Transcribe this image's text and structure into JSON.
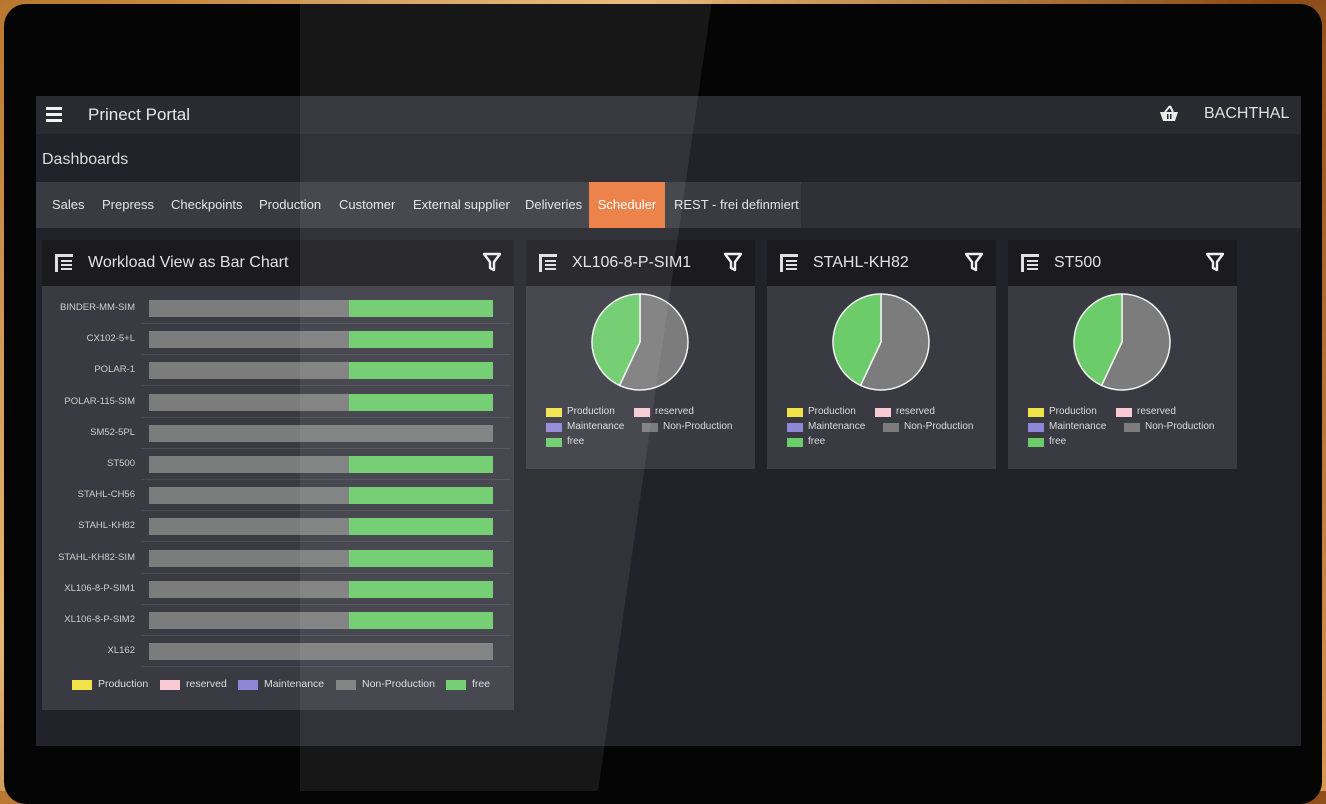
{
  "app": {
    "title": "Prinect Portal",
    "user": "BACHTHAL",
    "section": "Dashboards"
  },
  "tabs": [
    {
      "label": "Sales"
    },
    {
      "label": "Prepress"
    },
    {
      "label": "Checkpoints"
    },
    {
      "label": "Production"
    },
    {
      "label": "Customer"
    },
    {
      "label": "External supplier"
    },
    {
      "label": "Deliveries"
    },
    {
      "label": "Scheduler",
      "active": true
    },
    {
      "label": "REST - frei definmiert"
    }
  ],
  "colors": {
    "accent": "#ea7a3c",
    "production": "#f2e24a",
    "reserved": "#f7c9d3",
    "maintenance": "#8f86d6",
    "non_production": "#7c7c7c",
    "free": "#6dcc6a"
  },
  "icons": {
    "menu": "hamburger-icon",
    "basket": "basket-icon",
    "table": "table-icon",
    "filter": "filter-icon"
  },
  "bar_panel": {
    "title": "Workload View as Bar Chart",
    "legend": [
      "Production",
      "reserved",
      "Maintenance",
      "Non-Production",
      "free"
    ]
  },
  "pie_panels": [
    {
      "title": "XL106-8-P-SIM1",
      "legend": [
        "Production",
        "reserved",
        "Maintenance",
        "Non-Production",
        "free"
      ]
    },
    {
      "title": "STAHL-KH82",
      "legend": [
        "Production",
        "reserved",
        "Maintenance",
        "Non-Production",
        "free"
      ]
    },
    {
      "title": "ST500",
      "legend": [
        "Production",
        "reserved",
        "Maintenance",
        "Non-Production",
        "free"
      ]
    }
  ],
  "chart_data": [
    {
      "type": "bar",
      "orientation": "horizontal",
      "stacked": true,
      "title": "Workload View as Bar Chart",
      "categories": [
        "BINDER-MM-SIM",
        "CX102-5+L",
        "POLAR-1",
        "POLAR-115-SIM",
        "SM52-5PL",
        "ST500",
        "STAHL-CH56",
        "STAHL-KH82",
        "STAHL-KH82-SIM",
        "XL106-8-P-SIM1",
        "XL106-8-P-SIM2",
        "XL162"
      ],
      "series": [
        {
          "name": "Non-Production",
          "values": [
            58,
            58,
            58,
            58,
            100,
            58,
            58,
            58,
            58,
            58,
            58,
            100
          ]
        },
        {
          "name": "free",
          "values": [
            42,
            42,
            42,
            42,
            0,
            42,
            42,
            42,
            42,
            42,
            42,
            0
          ]
        }
      ],
      "legend": [
        "Production",
        "reserved",
        "Maintenance",
        "Non-Production",
        "free"
      ]
    },
    {
      "type": "pie",
      "title": "XL106-8-P-SIM1",
      "labels": [
        "Non-Production",
        "free"
      ],
      "values": [
        57,
        43
      ]
    },
    {
      "type": "pie",
      "title": "STAHL-KH82",
      "labels": [
        "Non-Production",
        "free"
      ],
      "values": [
        57,
        43
      ]
    },
    {
      "type": "pie",
      "title": "ST500",
      "labels": [
        "Non-Production",
        "free"
      ],
      "values": [
        57,
        43
      ]
    }
  ]
}
